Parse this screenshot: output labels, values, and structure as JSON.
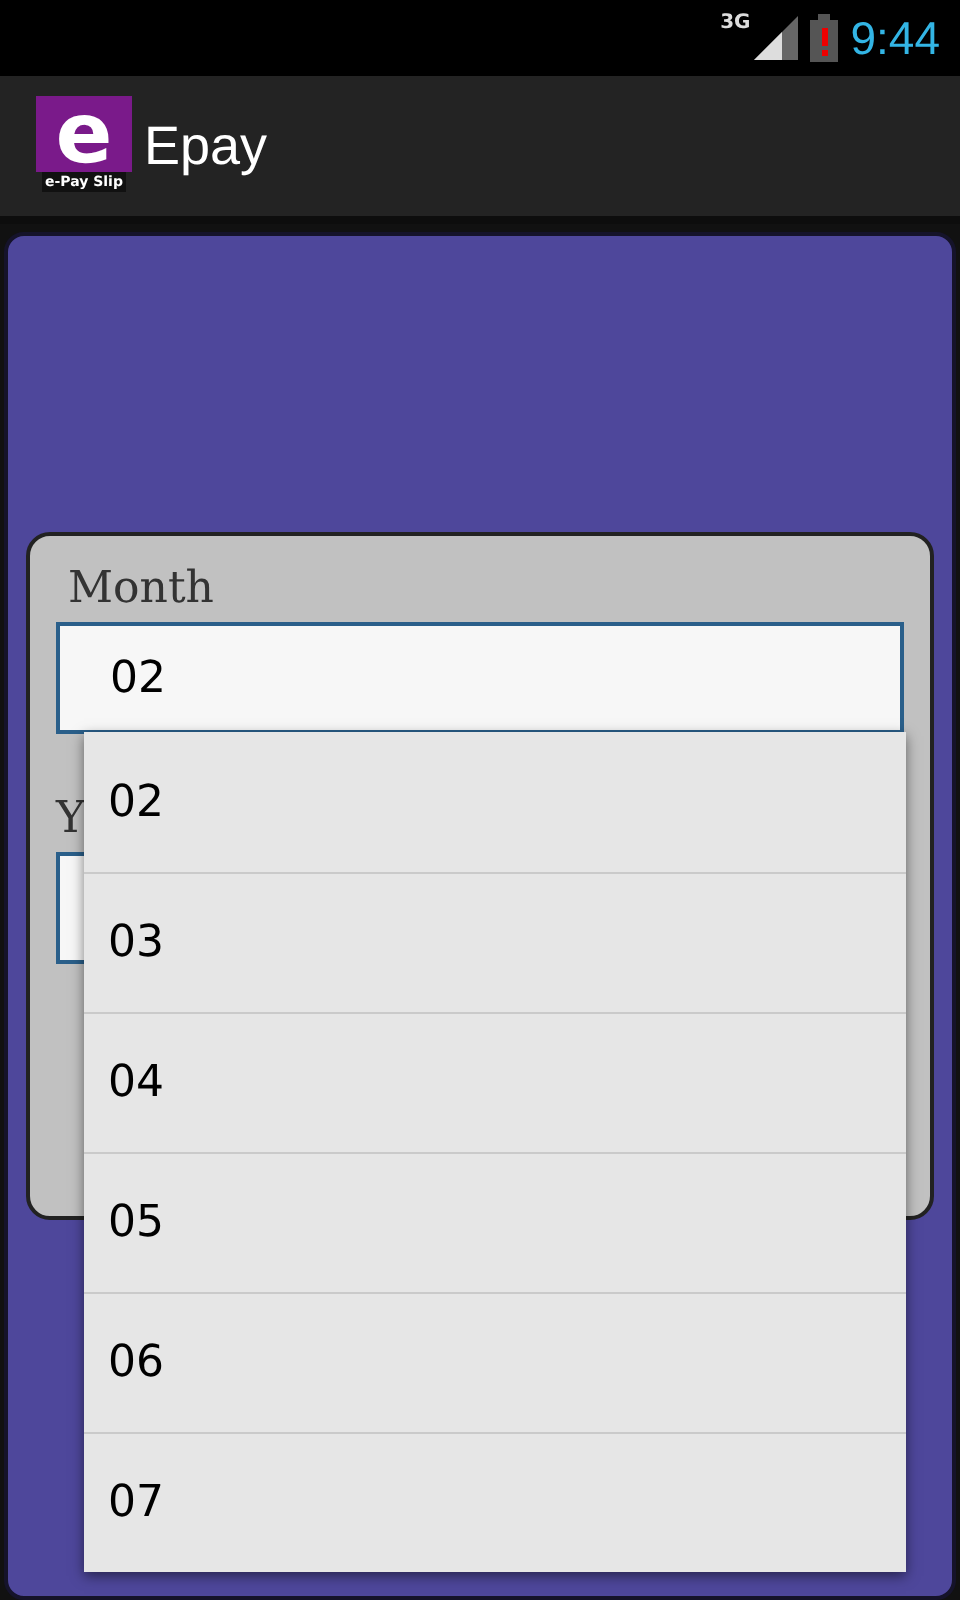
{
  "status_bar": {
    "network": "3G",
    "time": "9:44"
  },
  "action_bar": {
    "logo": {
      "mark": "e",
      "caption": "e-Pay Slip"
    },
    "title": "Epay"
  },
  "form": {
    "fields": [
      {
        "label": "Month",
        "value": "02"
      },
      {
        "label": "Y"
      }
    ]
  },
  "dropdown": {
    "options": [
      "02",
      "03",
      "04",
      "05",
      "06",
      "07"
    ]
  }
}
